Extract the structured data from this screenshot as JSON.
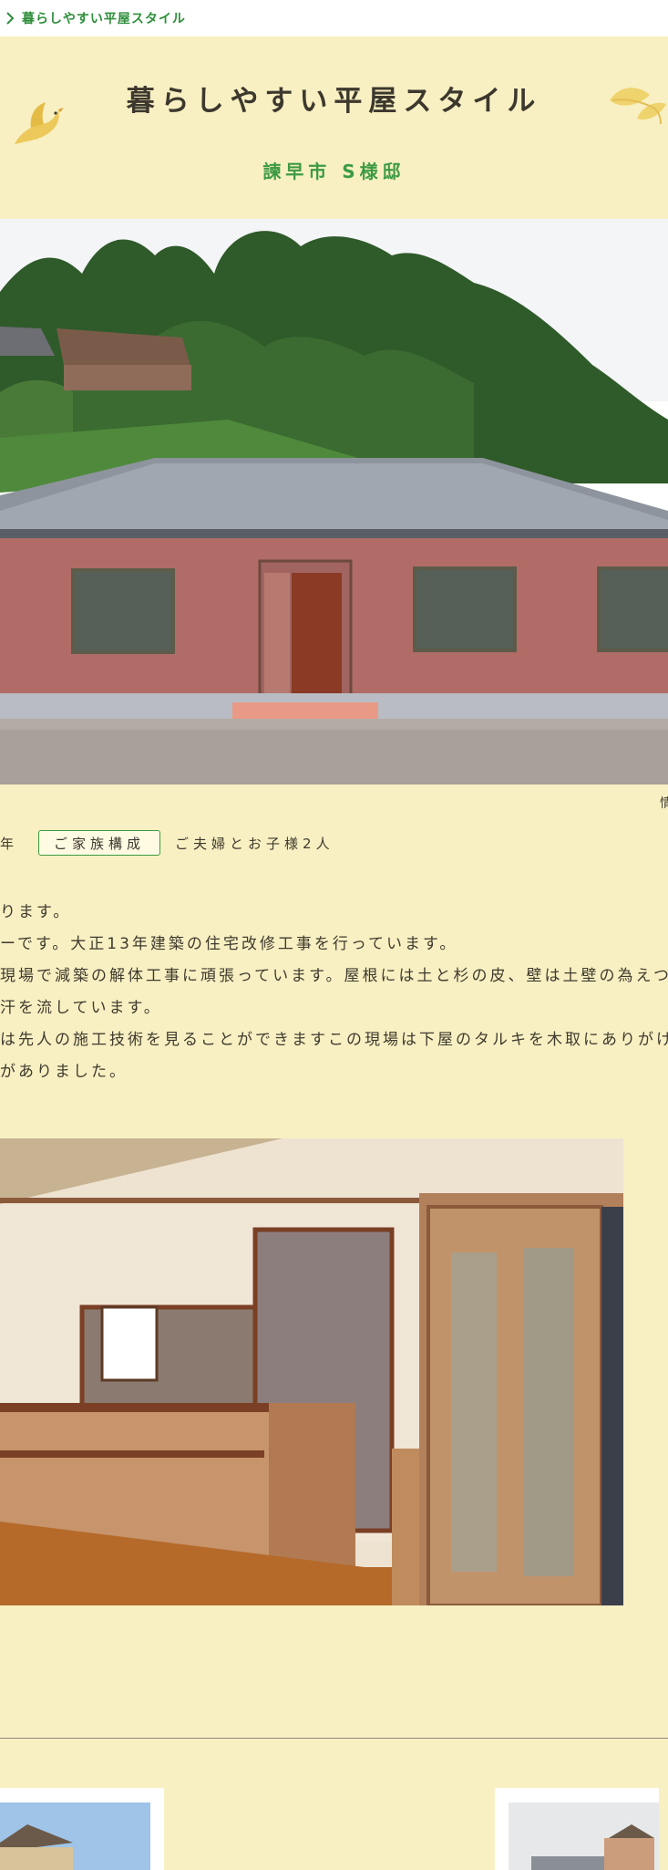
{
  "breadcrumb": {
    "icon": "chevron-right-icon",
    "text": "暮らしやすい平屋スタイル"
  },
  "hero": {
    "title": "暮らしやすい平屋スタイル",
    "subtitle": "諫早市 S様邸",
    "decorations": [
      "bird-icon",
      "leaf-icon"
    ]
  },
  "photo_caption_mark": "情",
  "info": {
    "year_suffix": "年",
    "family_label": "ご家族構成",
    "family_value": "ご夫婦とお子様2人"
  },
  "body_lines": [
    "ります。",
    "ーです。大正13年建築の住宅改修工事を行っています。",
    "現場で減築の解体工事に頑張っています。屋根には土と杉の皮、壁は土壁の為えつりの竹",
    "汗を流しています。",
    "は先人の施工技術を見ることができますこの現場は下屋のタルキを木取にありがけで施工",
    "がありました。"
  ],
  "colors": {
    "background": "#f8f0c2",
    "accent_green": "#3d9a44",
    "text": "#3f3a2f"
  }
}
